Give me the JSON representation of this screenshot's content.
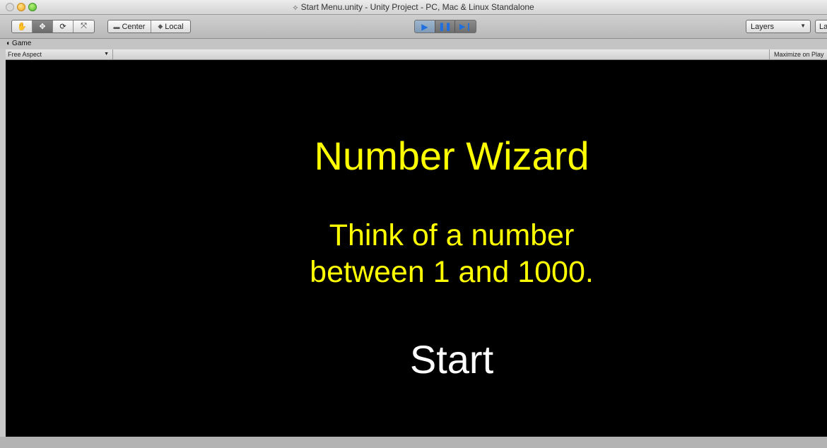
{
  "window": {
    "title": "Start Menu.unity - Unity Project - PC, Mac & Linux Standalone",
    "title_icon": "unity-scene-icon"
  },
  "toolbar": {
    "tools": [
      "hand-tool-icon",
      "move-tool-icon",
      "rotate-tool-icon",
      "scale-tool-icon"
    ],
    "active_tool": "move-tool-icon",
    "pivot_label": "Center",
    "space_label": "Local",
    "play_controls": [
      "play-icon",
      "pause-icon",
      "step-icon"
    ],
    "layers_label": "Layers",
    "layout_label": "La"
  },
  "game_tab": {
    "label": "Game",
    "aspect_label": "Free Aspect",
    "maximize_label": "Maximize on Play"
  },
  "game_view": {
    "title": "Number Wizard",
    "prompt_line1": "Think of a number",
    "prompt_line2": "between 1 and 1000.",
    "start_label": "Start",
    "text_color": "#ffff00",
    "start_color": "#ffffff",
    "background": "#000000"
  }
}
